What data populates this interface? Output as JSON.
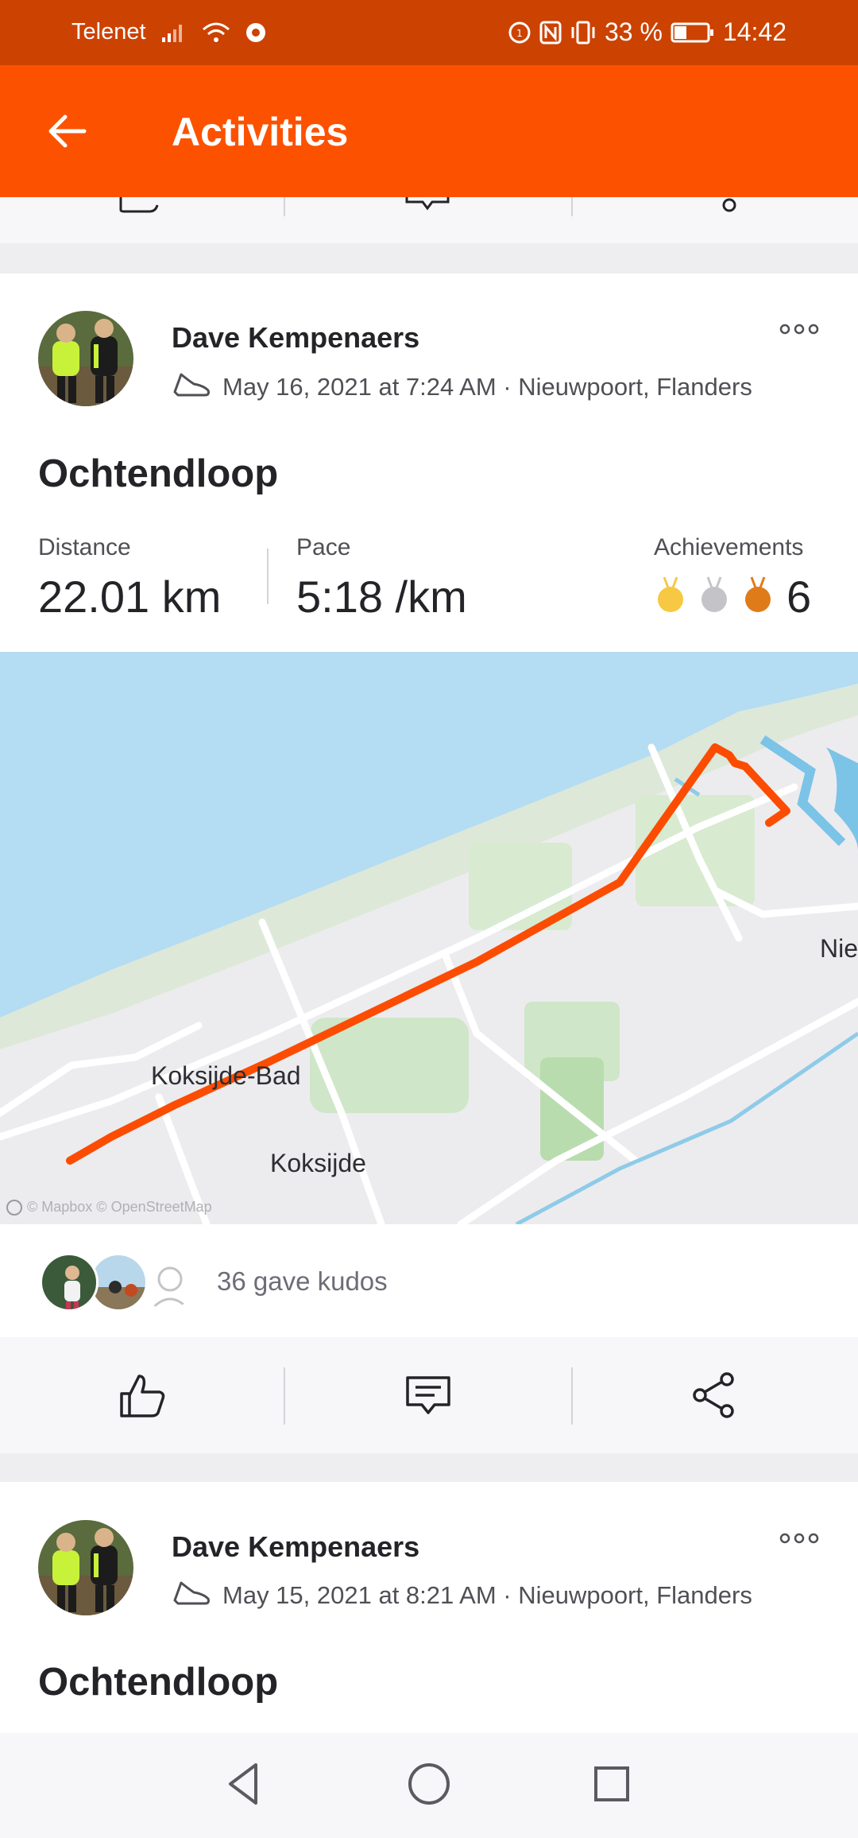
{
  "status_bar": {
    "carrier": "Telenet",
    "battery": "33 %",
    "time": "14:42"
  },
  "app_bar": {
    "title": "Activities",
    "back_icon": "arrow-left-icon"
  },
  "feed": [
    {
      "athlete": "Dave Kempenaers",
      "activity_icon": "run-shoe-icon",
      "meta": "May 16, 2021 at 7:24 AM · Nieuwpoort, Flanders",
      "title": "Ochtendloop",
      "stats": {
        "distance_label": "Distance",
        "distance_value": "22.01 km",
        "pace_label": "Pace",
        "pace_value": "5:18 /km",
        "achievements_label": "Achievements",
        "achievements_count": "6",
        "medals": [
          "gold",
          "silver",
          "bronze"
        ]
      },
      "map": {
        "labels": [
          "Koksijde-Bad",
          "Koksijde",
          "Nie"
        ],
        "attribution": "© Mapbox © OpenStreetMap",
        "route_color": "#fc4c02",
        "sea_color": "#b4dcf2"
      },
      "kudos_text": "36 gave kudos"
    },
    {
      "athlete": "Dave Kempenaers",
      "activity_icon": "run-shoe-icon",
      "meta": "May 15, 2021 at 8:21 AM · Nieuwpoort, Flanders",
      "title": "Ochtendloop"
    }
  ],
  "colors": {
    "brand": "#fc5200",
    "status_bar": "#cc4200"
  }
}
